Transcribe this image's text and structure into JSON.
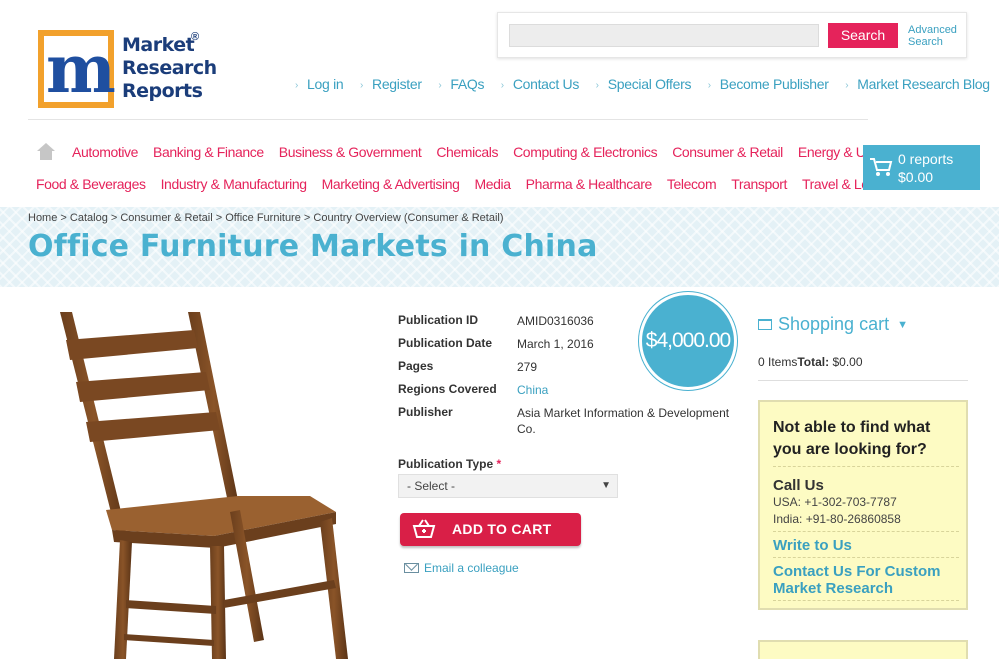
{
  "logo": {
    "letter": "m",
    "lines": [
      "Market",
      "Research",
      "Reports"
    ],
    "registered": "®"
  },
  "search": {
    "button": "Search",
    "advanced_line1": "Advanced",
    "advanced_line2": "Search",
    "placeholder": ""
  },
  "top_links": [
    "Log in",
    "Register",
    "FAQs",
    "Contact Us",
    "Special Offers",
    "Become Publisher",
    "Market Research Blog"
  ],
  "categories_row1": [
    "Automotive",
    "Banking & Finance",
    "Business & Government",
    "Chemicals",
    "Computing & Electronics",
    "Consumer & Retail",
    "Energy & Utilities"
  ],
  "categories_row2": [
    "Food & Beverages",
    "Industry & Manufacturing",
    "Marketing & Advertising",
    "Media",
    "Pharma & Healthcare",
    "Telecom",
    "Transport",
    "Travel & Leisure"
  ],
  "cart_header": {
    "count": "0 reports",
    "total": "$0.00"
  },
  "breadcrumb": [
    "Home",
    "Catalog",
    "Consumer & Retail",
    "Office Furniture",
    "Country Overview (Consumer & Retail)"
  ],
  "page_title": "Office Furniture Markets in China",
  "details": {
    "publication_id": {
      "label": "Publication ID",
      "value": "AMID0316036"
    },
    "publication_date": {
      "label": "Publication Date",
      "value": "March 1, 2016"
    },
    "pages": {
      "label": "Pages",
      "value": "279"
    },
    "regions": {
      "label": "Regions Covered",
      "value": "China"
    },
    "publisher": {
      "label": "Publisher",
      "value": "Asia Market Information & Development Co."
    }
  },
  "price": "$4,000.00",
  "publication_type": {
    "label": "Publication Type",
    "required": "*",
    "selected": "- Select -"
  },
  "add_to_cart": "ADD TO CART",
  "email_colleague": "Email a colleague",
  "sidebar": {
    "cart_title": "Shopping cart",
    "items": "0 Items",
    "total_label": "Total:",
    "total_value": "$0.00",
    "help_title": "Not able to find what you are looking for?",
    "call_us": "Call Us",
    "usa_phone": "USA: +1-302-703-7787",
    "india_phone": "India: +91-80-26860858",
    "write_to_us": "Write to Us",
    "custom_research": "Contact Us For Custom Market Research"
  },
  "colors": {
    "accent_blue": "#4ab1d0",
    "accent_pink": "#e5235b",
    "logo_orange": "#f2a12c"
  }
}
